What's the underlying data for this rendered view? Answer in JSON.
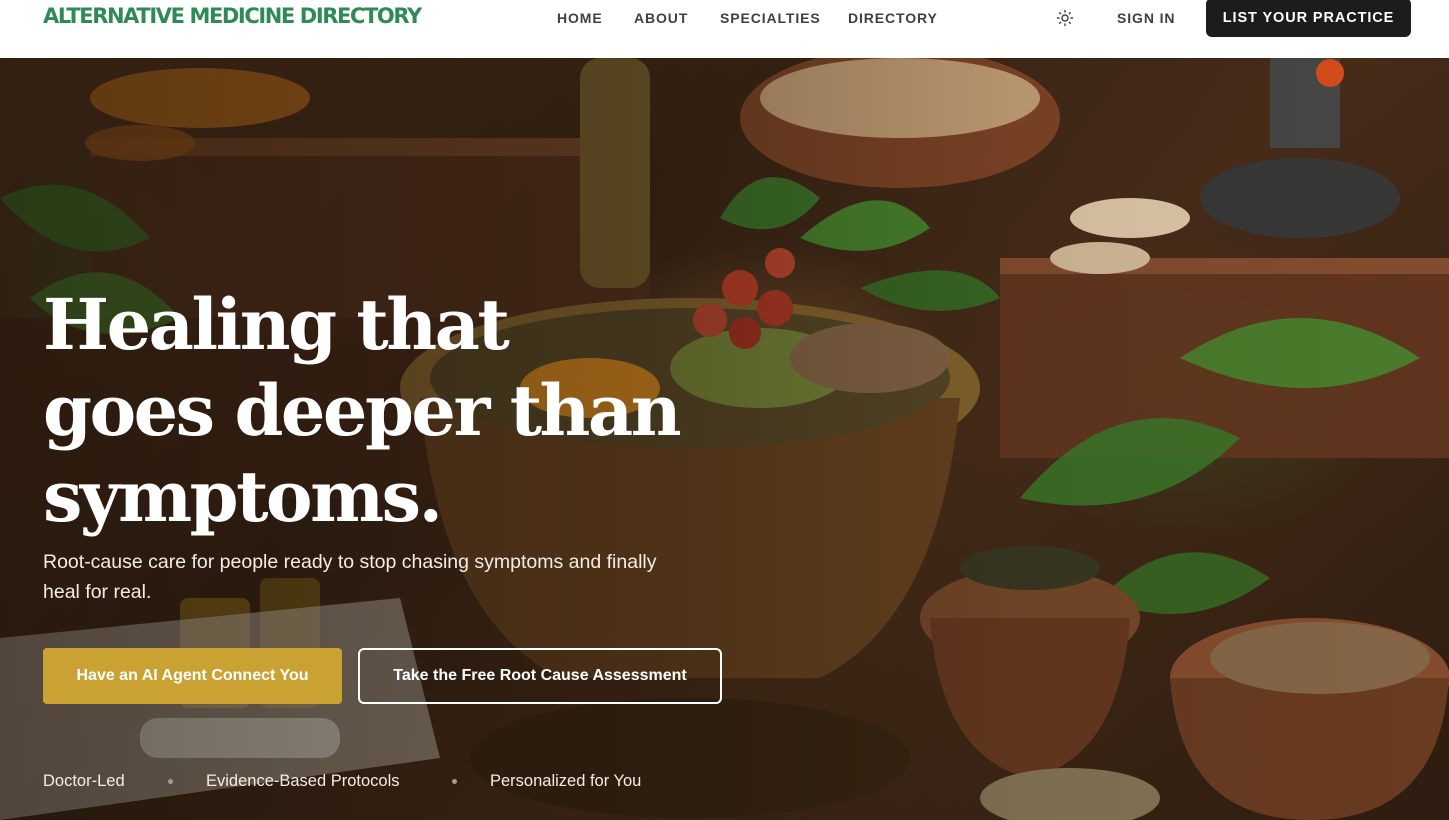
{
  "header": {
    "logo": "ALTERNATIVE MEDICINE DIRECTORY",
    "nav": [
      "HOME",
      "ABOUT",
      "SPECIALTIES",
      "DIRECTORY"
    ],
    "theme_toggle_icon": "sun-icon",
    "sign_in": "SIGN IN",
    "cta": "LIST YOUR PRACTICE"
  },
  "hero": {
    "background": "herbs-mortar-photo",
    "headline": "Healing that goes deeper than symptoms.",
    "subtext": "Root-cause care for people ready to stop chasing symptoms and finally heal for real.",
    "primary_button": "Have an AI Agent Connect You",
    "secondary_button": "Take the Free Root Cause Assessment",
    "features": [
      "Doctor-Led",
      "Evidence-Based Protocols",
      "Personalized for You"
    ]
  },
  "colors": {
    "brand_green": "#2f8a55",
    "accent_gold": "#c9a233",
    "dark_button": "#1c1c1c",
    "nav_text": "#3b4147"
  }
}
